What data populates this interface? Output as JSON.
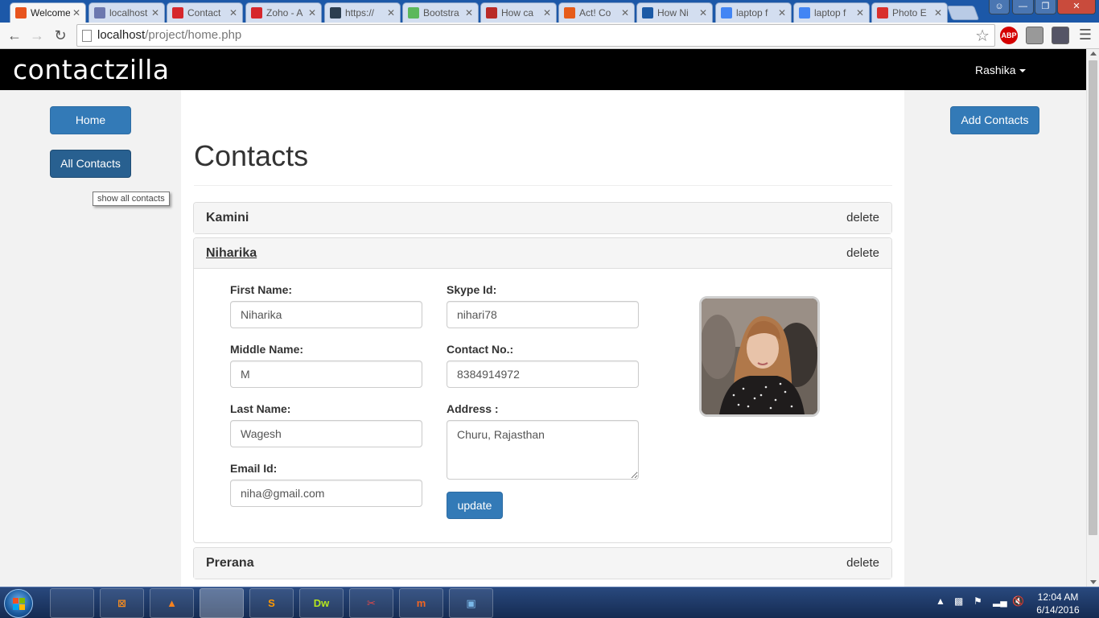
{
  "browser": {
    "tabs": [
      {
        "label": "Welcome",
        "favicon": "xampp-icon",
        "color": "#e8541d",
        "active": true
      },
      {
        "label": "localhost",
        "favicon": "phpmyadmin-icon",
        "color": "#6c78af"
      },
      {
        "label": "Contact",
        "favicon": "zoho-icon",
        "color": "#d6272c"
      },
      {
        "label": "Zoho - A",
        "favicon": "zoho-icon",
        "color": "#d6272c"
      },
      {
        "label": "https://",
        "favicon": "circle-p-icon",
        "color": "#2c3e50"
      },
      {
        "label": "Bootstra",
        "favicon": "bootsnipp-icon",
        "color": "#5cb85c"
      },
      {
        "label": "How ca",
        "favicon": "quora-icon",
        "color": "#b92b27"
      },
      {
        "label": "Act! Co",
        "favicon": "act-icon",
        "color": "#e65c1a"
      },
      {
        "label": "How Ni",
        "favicon": "crm-icon",
        "color": "#1b5aa6"
      },
      {
        "label": "laptop f",
        "favicon": "google-icon",
        "color": "#4285f4"
      },
      {
        "label": "laptop f",
        "favicon": "google-icon",
        "color": "#4285f4"
      },
      {
        "label": "Photo E",
        "favicon": "photo-editor-icon",
        "color": "#d9302c"
      }
    ],
    "url_host": "localhost",
    "url_path": "/project/home.php",
    "extensions": [
      {
        "name": "adblock-plus-icon",
        "text": "ABP"
      },
      {
        "name": "extension-icon",
        "text": ""
      },
      {
        "name": "shield-extension-icon",
        "text": ""
      }
    ]
  },
  "site": {
    "brand": "contactzilla",
    "user": "Rashika"
  },
  "sidebar": {
    "home_label": "Home",
    "all_contacts_label": "All Contacts",
    "tooltip": "show all contacts"
  },
  "actions": {
    "add_contacts_label": "Add Contacts"
  },
  "main": {
    "title": "Contacts",
    "delete_label": "delete",
    "contacts": [
      "Kamini",
      "Niharika",
      "Prerana"
    ]
  },
  "form": {
    "first_name_label": "First Name:",
    "first_name": "Niharika",
    "middle_name_label": "Middle Name:",
    "middle_name": "M",
    "last_name_label": "Last Name:",
    "last_name": "Wagesh",
    "email_label": "Email Id:",
    "email": "niha@gmail.com",
    "skype_label": "Skype Id:",
    "skype": "nihari78",
    "contact_label": "Contact No.:",
    "contact": "8384914972",
    "address_label": "Address :",
    "address": "Churu, Rajasthan",
    "update_label": "update"
  },
  "taskbar": {
    "apps": [
      {
        "name": "file-explorer-icon",
        "text": "",
        "color": "#e8c35a"
      },
      {
        "name": "xampp-icon",
        "text": "⊠",
        "color": "#f28b20"
      },
      {
        "name": "vlc-icon",
        "text": "▲",
        "color": "#f58220"
      },
      {
        "name": "chrome-icon",
        "text": "",
        "color": "#db4437",
        "active": true
      },
      {
        "name": "sublime-text-icon",
        "text": "S",
        "color": "#ff9800"
      },
      {
        "name": "dreamweaver-icon",
        "text": "Dw",
        "color": "#b5e61d"
      },
      {
        "name": "snipping-tool-icon",
        "text": "✂",
        "color": "#e04848"
      },
      {
        "name": "micromax-icon",
        "text": "m",
        "color": "#f26522"
      },
      {
        "name": "photo-viewer-icon",
        "text": "▣",
        "color": "#7ab8e8"
      }
    ],
    "time": "12:04 AM",
    "date": "6/14/2016"
  }
}
